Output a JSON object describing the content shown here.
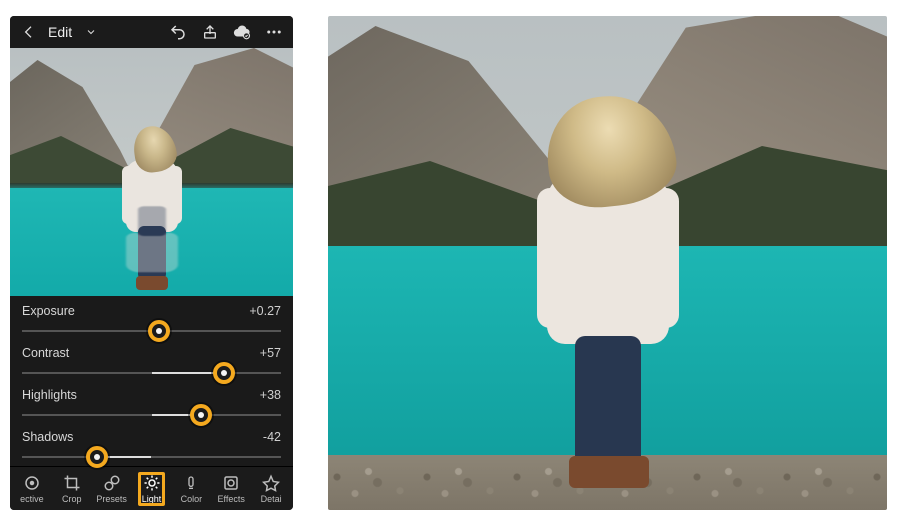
{
  "header": {
    "title": "Edit"
  },
  "sliders": [
    {
      "label": "Exposure",
      "display": "+0.27",
      "value": 0.27,
      "min": -5,
      "max": 5,
      "percent": 53
    },
    {
      "label": "Contrast",
      "display": "+57",
      "value": 57,
      "min": -100,
      "max": 100,
      "percent": 78
    },
    {
      "label": "Highlights",
      "display": "+38",
      "value": 38,
      "min": -100,
      "max": 100,
      "percent": 69
    },
    {
      "label": "Shadows",
      "display": "-42",
      "value": -42,
      "min": -100,
      "max": 100,
      "percent": 29
    }
  ],
  "tools": [
    {
      "label": "ective",
      "icon": "selective",
      "selected": false
    },
    {
      "label": "Crop",
      "icon": "crop",
      "selected": false
    },
    {
      "label": "Presets",
      "icon": "presets",
      "selected": false
    },
    {
      "label": "Light",
      "icon": "light",
      "selected": true
    },
    {
      "label": "Color",
      "icon": "color",
      "selected": false
    },
    {
      "label": "Effects",
      "icon": "effects",
      "selected": false
    },
    {
      "label": "Detai",
      "icon": "detail",
      "selected": false
    }
  ],
  "colors": {
    "accent": "#f4a91f"
  }
}
